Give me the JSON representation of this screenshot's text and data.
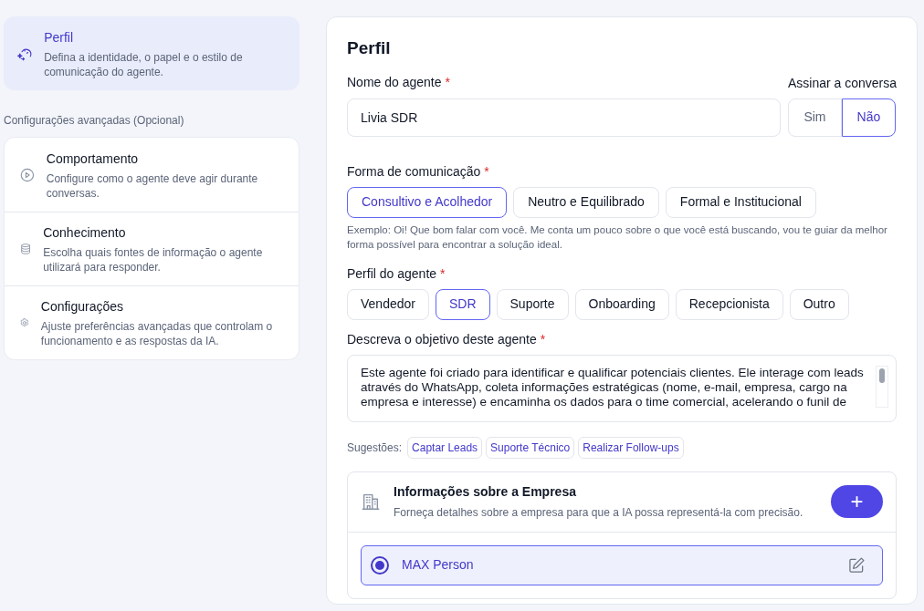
{
  "sidebar": {
    "primary": {
      "title": "Perfil",
      "description": "Defina a identidade, o papel e o estilo de comunicação do agente.",
      "selected": true
    },
    "advanced_heading": "Configurações avançadas (Opcional)",
    "advanced_items": [
      {
        "title": "Comportamento",
        "description": "Configure como o agente deve agir durante conversas.",
        "selected": false
      },
      {
        "title": "Conhecimento",
        "description": "Escolha quais fontes de informação o agente utilizará para responder.",
        "selected": false
      },
      {
        "title": "Configurações",
        "description": "Ajuste preferências avançadas que controlam o funcionamento e as respostas da IA.",
        "selected": false
      }
    ]
  },
  "form": {
    "title": "Perfil",
    "name_field": {
      "label": "Nome do agente",
      "required_mark": "*",
      "value": "Livia SDR"
    },
    "sign": {
      "label": "Assinar a conversa",
      "options": [
        {
          "label": "Sim",
          "selected": false
        },
        {
          "label": "Não",
          "selected": true
        }
      ]
    },
    "communication": {
      "label": "Forma de comunicação",
      "required_mark": "*",
      "options": [
        {
          "label": "Consultivo e Acolhedor",
          "selected": true
        },
        {
          "label": "Neutro e Equilibrado",
          "selected": false
        },
        {
          "label": "Formal e Institucional",
          "selected": false
        }
      ],
      "example": "Exemplo: Oi! Que bom falar com você. Me conta um pouco sobre o que você está buscando, vou te guiar da melhor forma possível para encontrar a solução ideal."
    },
    "profile": {
      "label": "Perfil do agente",
      "required_mark": "*",
      "options": [
        {
          "label": "Vendedor",
          "selected": false
        },
        {
          "label": "SDR",
          "selected": true
        },
        {
          "label": "Suporte",
          "selected": false
        },
        {
          "label": "Onboarding",
          "selected": false
        },
        {
          "label": "Recepcionista",
          "selected": false
        },
        {
          "label": "Outro",
          "selected": false
        }
      ]
    },
    "objective": {
      "label": "Descreva o objetivo deste agente",
      "required_mark": "*",
      "value": "Este agente foi criado para identificar e qualificar potenciais clientes. Ele interage com leads através do WhatsApp, coleta informações estratégicas (nome, e-mail, empresa, cargo na empresa e interesse) e encaminha os dados para o time comercial, acelerando o funil de"
    },
    "suggestions": {
      "label": "Sugestões:",
      "items": [
        "Captar Leads",
        "Suporte Técnico",
        "Realizar Follow-ups"
      ]
    },
    "company": {
      "title": "Informações sobre a Empresa",
      "description": "Forneça detalhes sobre a empresa para que a IA possa representá-la com precisão.",
      "add_label": "+",
      "items": [
        {
          "name": "MAX Person",
          "selected": true
        }
      ]
    }
  }
}
